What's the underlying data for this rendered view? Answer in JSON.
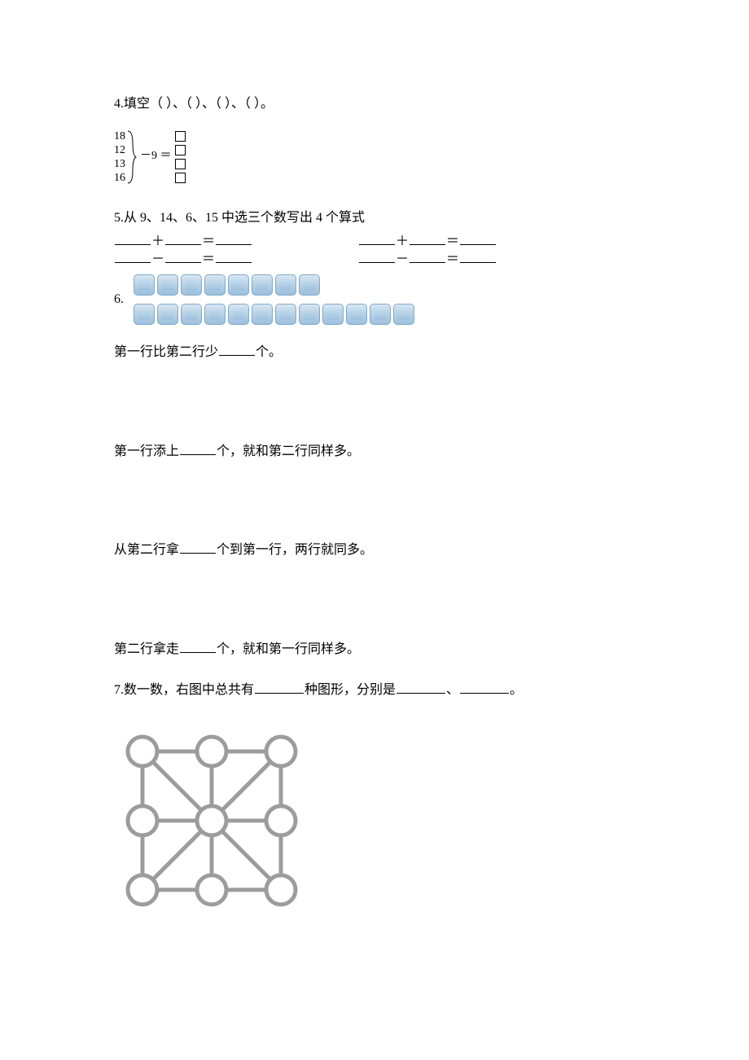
{
  "q4": {
    "label": "4.填空（     ）、（     ）、（     ）、（     ）。",
    "nums": [
      "18",
      "12",
      "13",
      "16"
    ],
    "op": "－9 ＝"
  },
  "q5": {
    "label": "5.从 9、14、6、15 中选三个数写出 4 个算式",
    "plus": "＋",
    "minus": "－",
    "eq": "＝"
  },
  "q6": {
    "num": "6.",
    "row1_count": 8,
    "row2_count": 12,
    "line1a": "第一行比第二行少",
    "line1b": "个。",
    "line2a": "第一行添上",
    "line2b": "个，就和第二行同样多。",
    "line3a": "从第二行拿",
    "line3b": "个到第一行，两行就同多。",
    "line4a": "第二行拿走",
    "line4b": "个，就和第一行同样多。"
  },
  "q7": {
    "text_a": "7.数一数，右图中总共有",
    "text_b": "种图形，分别是",
    "sep": "、",
    "end": "。"
  }
}
